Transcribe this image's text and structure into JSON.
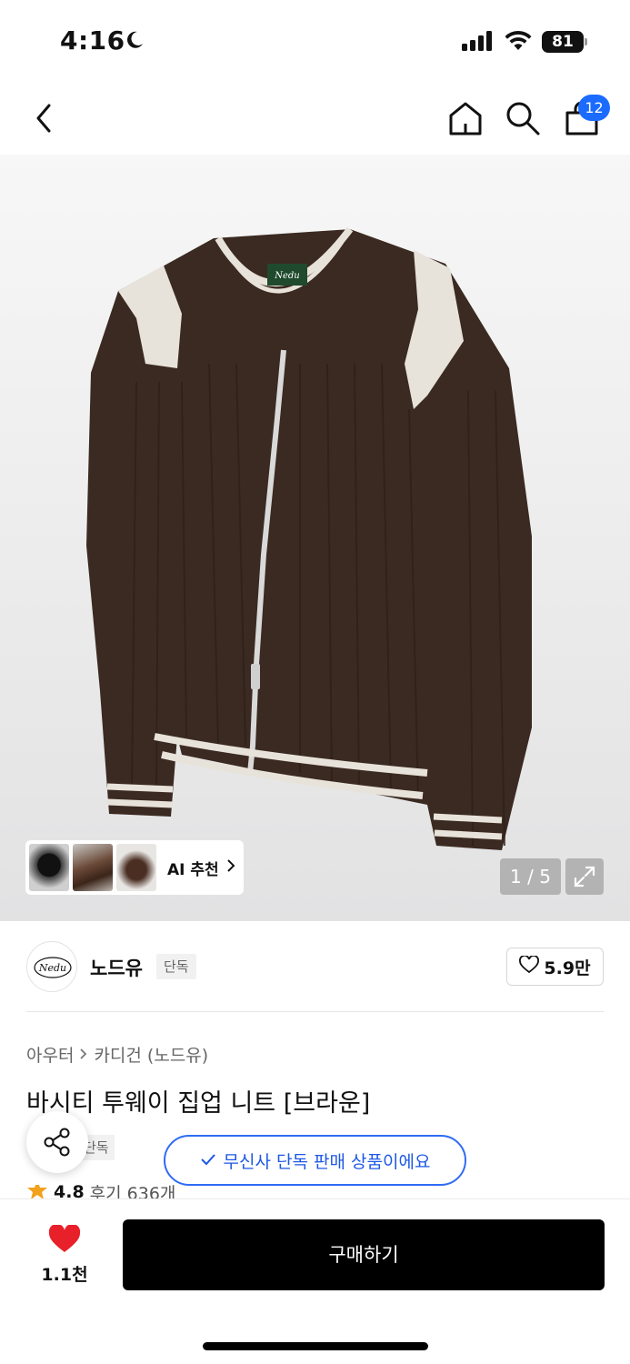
{
  "status_bar": {
    "time": "4:16",
    "battery": "81"
  },
  "nav": {
    "cart_count": "12"
  },
  "gallery": {
    "ai_label": "AI 추천",
    "counter": "1 / 5",
    "product_logo_text": "Nedu"
  },
  "brand": {
    "name": "노드유",
    "tag": "단독",
    "likes": "5.9만",
    "logo_text": "Nedu"
  },
  "breadcrumb": {
    "level1": "아우터",
    "level2": "카디건 (노드유)"
  },
  "product": {
    "title": "바시티 투웨이 집업 니트 [브라운]",
    "sub_tag": "단독",
    "exclusive_notice": "무신사 단독 판매 상품이에요",
    "rating": "4.8",
    "reviews": "후기 636개"
  },
  "bottom_bar": {
    "like_count": "1.1천",
    "buy_label": "구매하기"
  },
  "colors": {
    "accent_blue": "#1b6bff",
    "heart_red": "#e8202a",
    "star": "#f2a11c",
    "knit_brown": "#3b2a21"
  }
}
